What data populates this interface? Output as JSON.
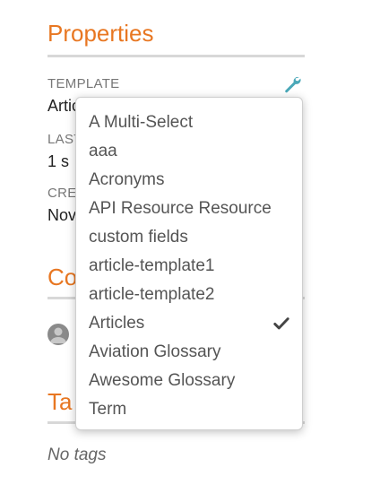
{
  "properties": {
    "title": "Properties",
    "template_label": "TEMPLATE",
    "template_value": "Articles",
    "last_label": "LAST",
    "last_value": "1 s",
    "created_label": "CREATED",
    "created_value": "Nov"
  },
  "contributors": {
    "title_fragment": "Co"
  },
  "tags": {
    "title_fragment": "Ta",
    "empty_text": "No tags"
  },
  "template_dropdown": {
    "items": [
      "A Multi-Select",
      "aaa",
      "Acronyms",
      "API Resource Resource",
      "custom fields",
      "article-template1",
      "article-template2",
      "Articles",
      "Aviation Glossary",
      "Awesome Glossary",
      "Term"
    ],
    "selected": "Articles"
  },
  "colors": {
    "accent_orange": "#e87722",
    "wrench_teal": "#4aa8b8"
  },
  "icons": {
    "edit": "wrench-icon",
    "selected": "checkmark-icon",
    "user": "avatar-icon"
  }
}
